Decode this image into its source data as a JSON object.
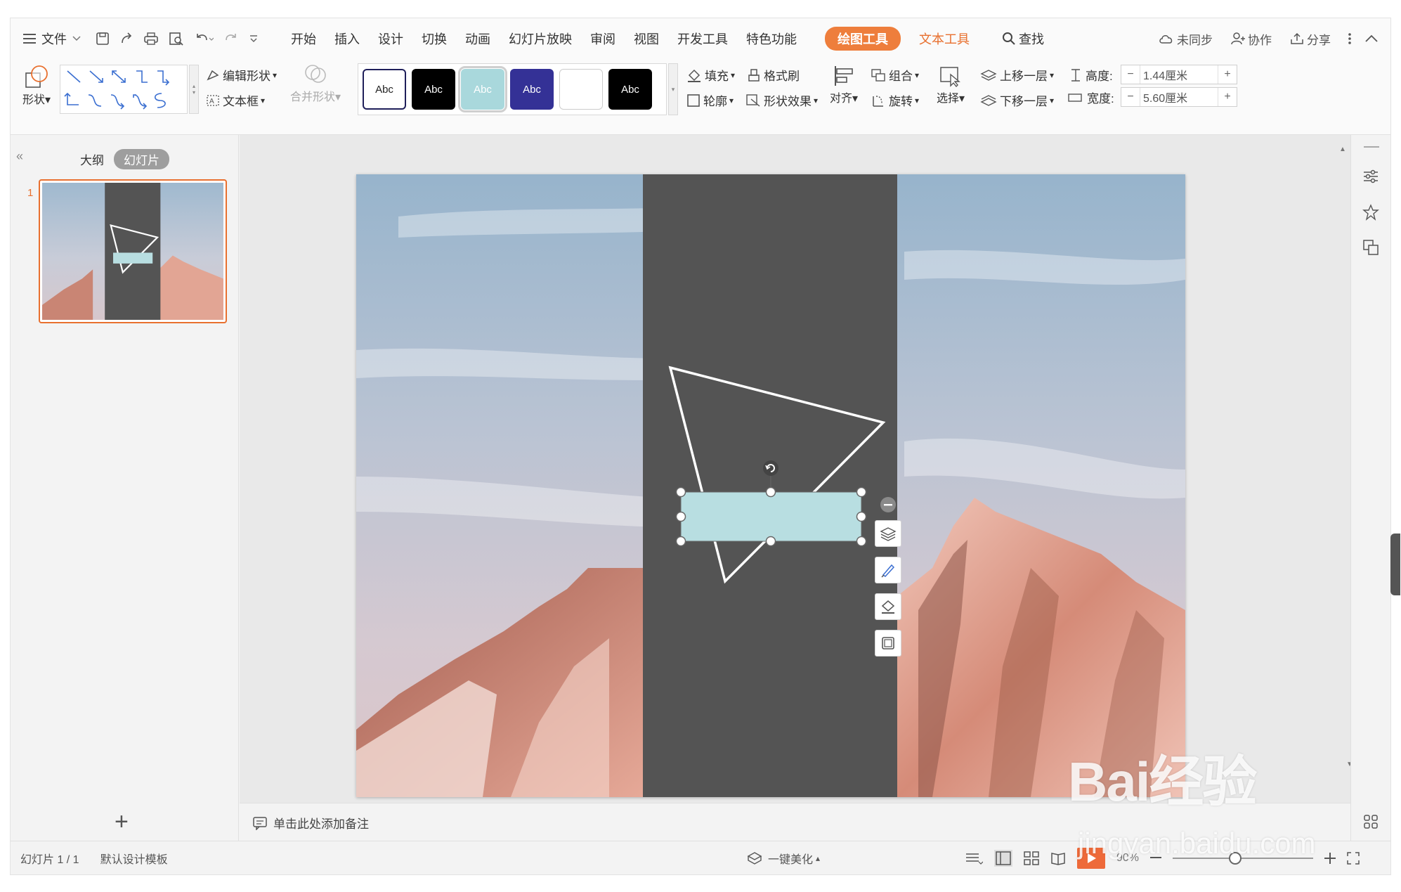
{
  "menu": {
    "file": "文件",
    "tabs": [
      "开始",
      "插入",
      "设计",
      "切换",
      "动画",
      "幻灯片放映",
      "审阅",
      "视图",
      "开发工具",
      "特色功能"
    ],
    "drawing_tools": "绘图工具",
    "text_tools": "文本工具",
    "search": "查找",
    "unsynced": "未同步",
    "collab": "协作",
    "share": "分享"
  },
  "ribbon": {
    "shape": "形状",
    "edit_shape": "编辑形状",
    "textbox": "文本框",
    "merge_shape": "合并形状",
    "style_label": "Abc",
    "fill": "填充",
    "format_brush": "格式刷",
    "outline": "轮廓",
    "shape_effect": "形状效果",
    "align": "对齐",
    "group": "组合",
    "rotate": "旋转",
    "select": "选择",
    "bring_forward": "上移一层",
    "send_backward": "下移一层",
    "height_label": "高度:",
    "height_value": "1.44厘米",
    "width_label": "宽度:",
    "width_value": "5.60厘米",
    "minus": "−",
    "plus": "+"
  },
  "colors": {
    "accent": "#ee7e3c",
    "panel": "#545454",
    "selected_rect": "#b8dee1",
    "style_teal": "#a9d8dc",
    "style_indigo": "#343196"
  },
  "left_panel": {
    "outline_tab": "大纲",
    "slides_tab": "幻灯片",
    "slide_number": "1",
    "add": "+"
  },
  "notes": {
    "placeholder": "单击此处添加备注"
  },
  "status": {
    "slide_info": "幻灯片 1 / 1",
    "template": "默认设计模板",
    "beautify": "一键美化",
    "zoom": "90%"
  },
  "watermark": {
    "brand": "Bai经验",
    "url": "jingyan.baidu.com"
  }
}
